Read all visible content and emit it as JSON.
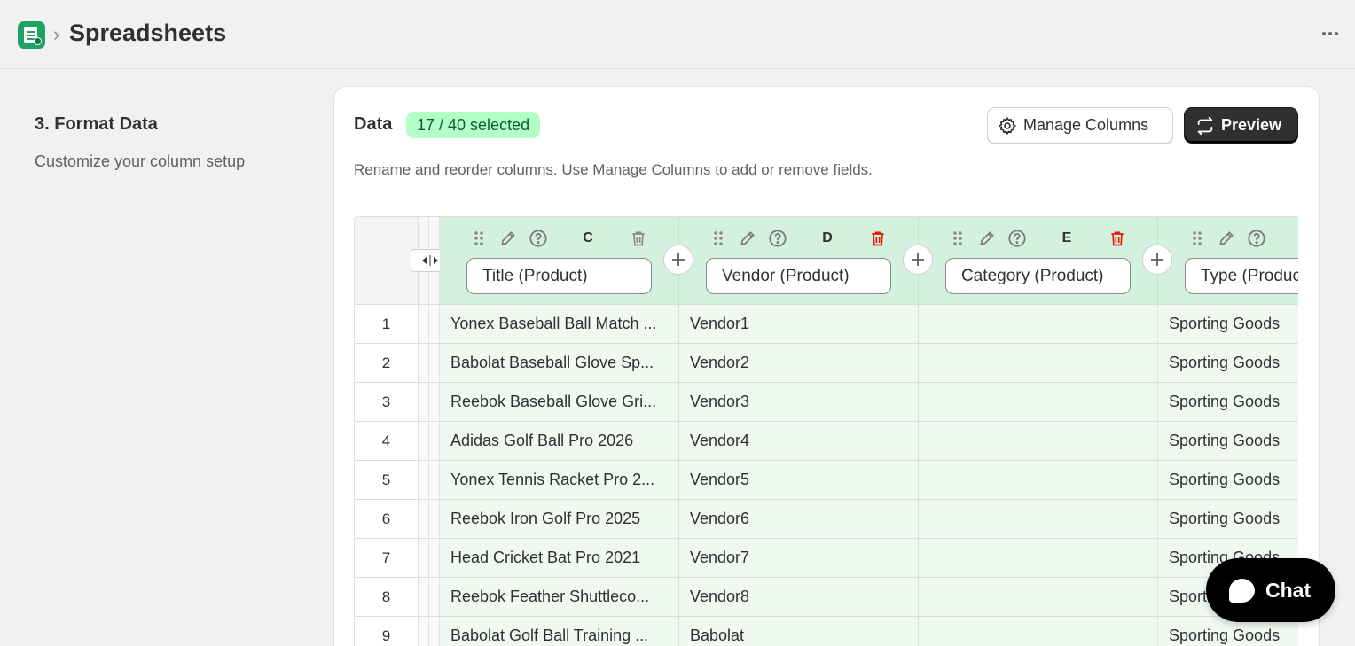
{
  "header": {
    "app_title": "Spreadsheets",
    "breadcrumb_separator": "›"
  },
  "step": {
    "title": "3. Format Data",
    "subtitle": "Customize your column setup"
  },
  "card": {
    "title": "Data",
    "selected_badge": "17 / 40 selected",
    "description": "Rename and reorder columns. Use Manage Columns to add or remove fields.",
    "manage_columns_label": "Manage Columns",
    "preview_label": "Preview"
  },
  "columns": [
    {
      "letter": "C",
      "name": "Title (Product)",
      "delete_color": "#8a8a8a"
    },
    {
      "letter": "D",
      "name": "Vendor (Product)",
      "delete_color": "#e51c00"
    },
    {
      "letter": "E",
      "name": "Category (Product)",
      "delete_color": "#e51c00"
    },
    {
      "letter": "",
      "name": "Type (Product)",
      "delete_color": "#8a8a8a"
    }
  ],
  "rows": [
    {
      "num": "1",
      "cells": [
        "Yonex Baseball Ball Match ...",
        "Vendor1",
        "",
        "Sporting Goods"
      ]
    },
    {
      "num": "2",
      "cells": [
        "Babolat Baseball Glove Sp...",
        "Vendor2",
        "",
        "Sporting Goods"
      ]
    },
    {
      "num": "3",
      "cells": [
        "Reebok Baseball Glove Gri...",
        "Vendor3",
        "",
        "Sporting Goods"
      ]
    },
    {
      "num": "4",
      "cells": [
        "Adidas Golf Ball Pro 2026",
        "Vendor4",
        "",
        "Sporting Goods"
      ]
    },
    {
      "num": "5",
      "cells": [
        "Yonex Tennis Racket Pro 2...",
        "Vendor5",
        "",
        "Sporting Goods"
      ]
    },
    {
      "num": "6",
      "cells": [
        "Reebok Iron Golf Pro 2025",
        "Vendor6",
        "",
        "Sporting Goods"
      ]
    },
    {
      "num": "7",
      "cells": [
        "Head Cricket Bat Pro 2021",
        "Vendor7",
        "",
        "Sporting Goods"
      ]
    },
    {
      "num": "8",
      "cells": [
        "Reebok Feather Shuttleco...",
        "Vendor8",
        "",
        "Sporting Goods"
      ]
    },
    {
      "num": "9",
      "cells": [
        "Babolat Golf Ball Training ...",
        "Babolat",
        "",
        "Sporting Goods"
      ]
    }
  ],
  "chat": {
    "label": "Chat"
  },
  "colors": {
    "accent_green": "#1ea362",
    "badge_bg": "#b4fec8",
    "column_header_bg": "#d3f1de",
    "cell_bg": "#eff9f1",
    "primary_button": "#303030",
    "danger": "#e51c00"
  }
}
